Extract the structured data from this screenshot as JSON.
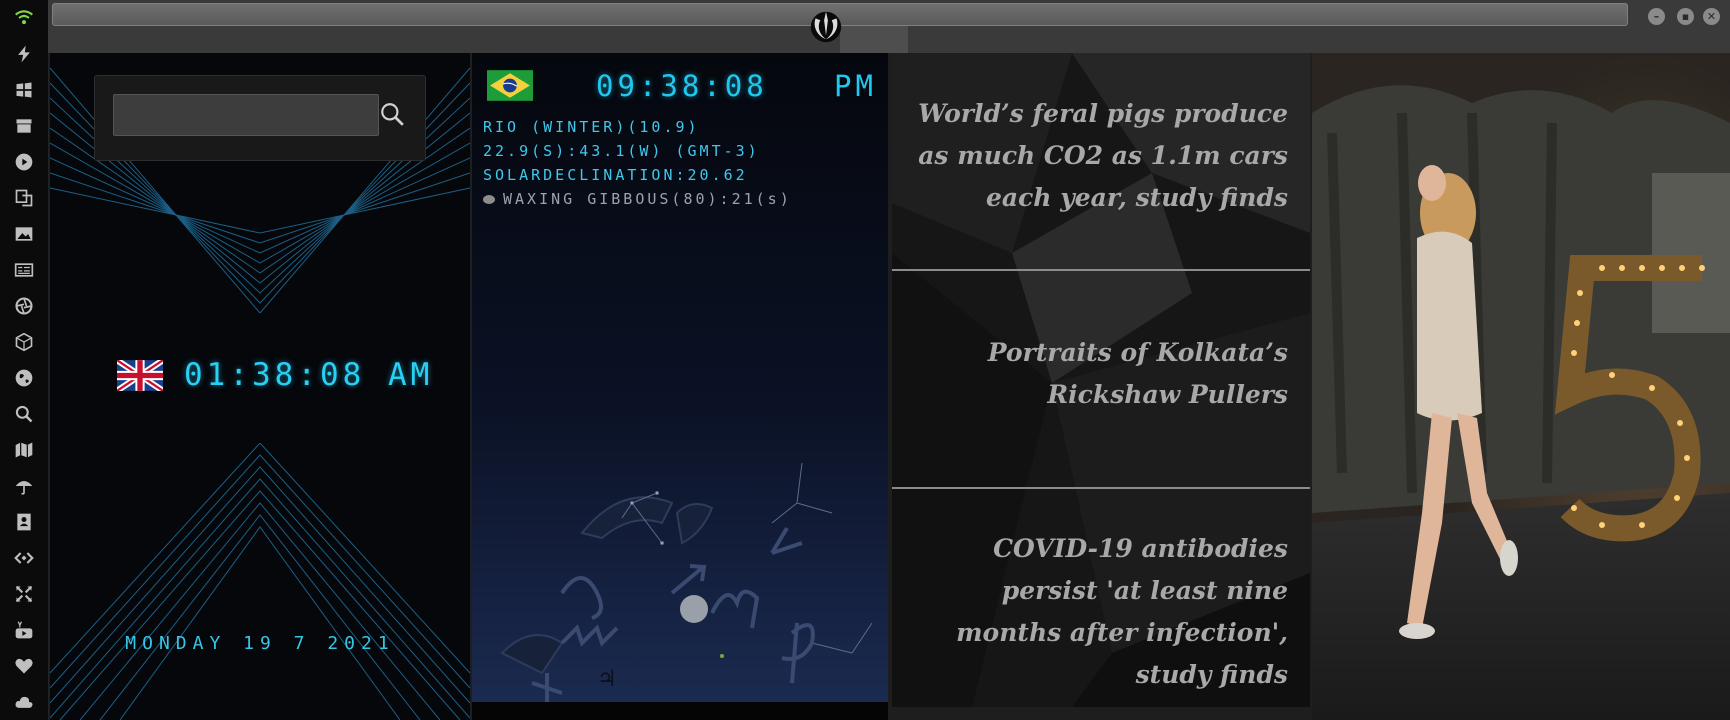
{
  "sidebar": {
    "icons": [
      "wifi-icon",
      "lightning-icon",
      "windows-icon",
      "archive-icon",
      "play-icon",
      "translate-icon",
      "image-icon",
      "newspaper-icon",
      "aperture-icon",
      "cube-icon",
      "globe-icon",
      "search-icon",
      "map-icon",
      "umbrella-icon",
      "contacts-icon",
      "code-icon",
      "expand-icon",
      "youtube-icon",
      "heart-icon",
      "cloud-icon"
    ],
    "active_color": "#7fd64b",
    "icon_color": "#bfbfbf"
  },
  "window": {
    "minimize": "–",
    "maximize": "▪",
    "close": "✕"
  },
  "search": {
    "value": "",
    "placeholder": ""
  },
  "uk_clock": {
    "time": "01:38:08 AM",
    "date": "MONDAY 19 7 2021"
  },
  "rio_clock": {
    "time": "09:38:08",
    "ampm": "PM",
    "line1": "RIO (WINTER)(10.9)",
    "line2": "22.9(S):43.1(W) (GMT-3)",
    "line3": "SOLARDECLINATION:20.62",
    "moon": "WAXING GIBBOUS(80):21(s)"
  },
  "news": [
    "World’s feral pigs produce as much CO2 as 1.1m cars each year, study finds",
    "Portraits of Kolkata’s Rickshaw Pullers",
    "COVID-19 antibodies persist 'at least nine months after infection', study finds"
  ],
  "colors": {
    "accent_cyan": "#2ad0f4",
    "news_text": "#a8a8a8"
  }
}
